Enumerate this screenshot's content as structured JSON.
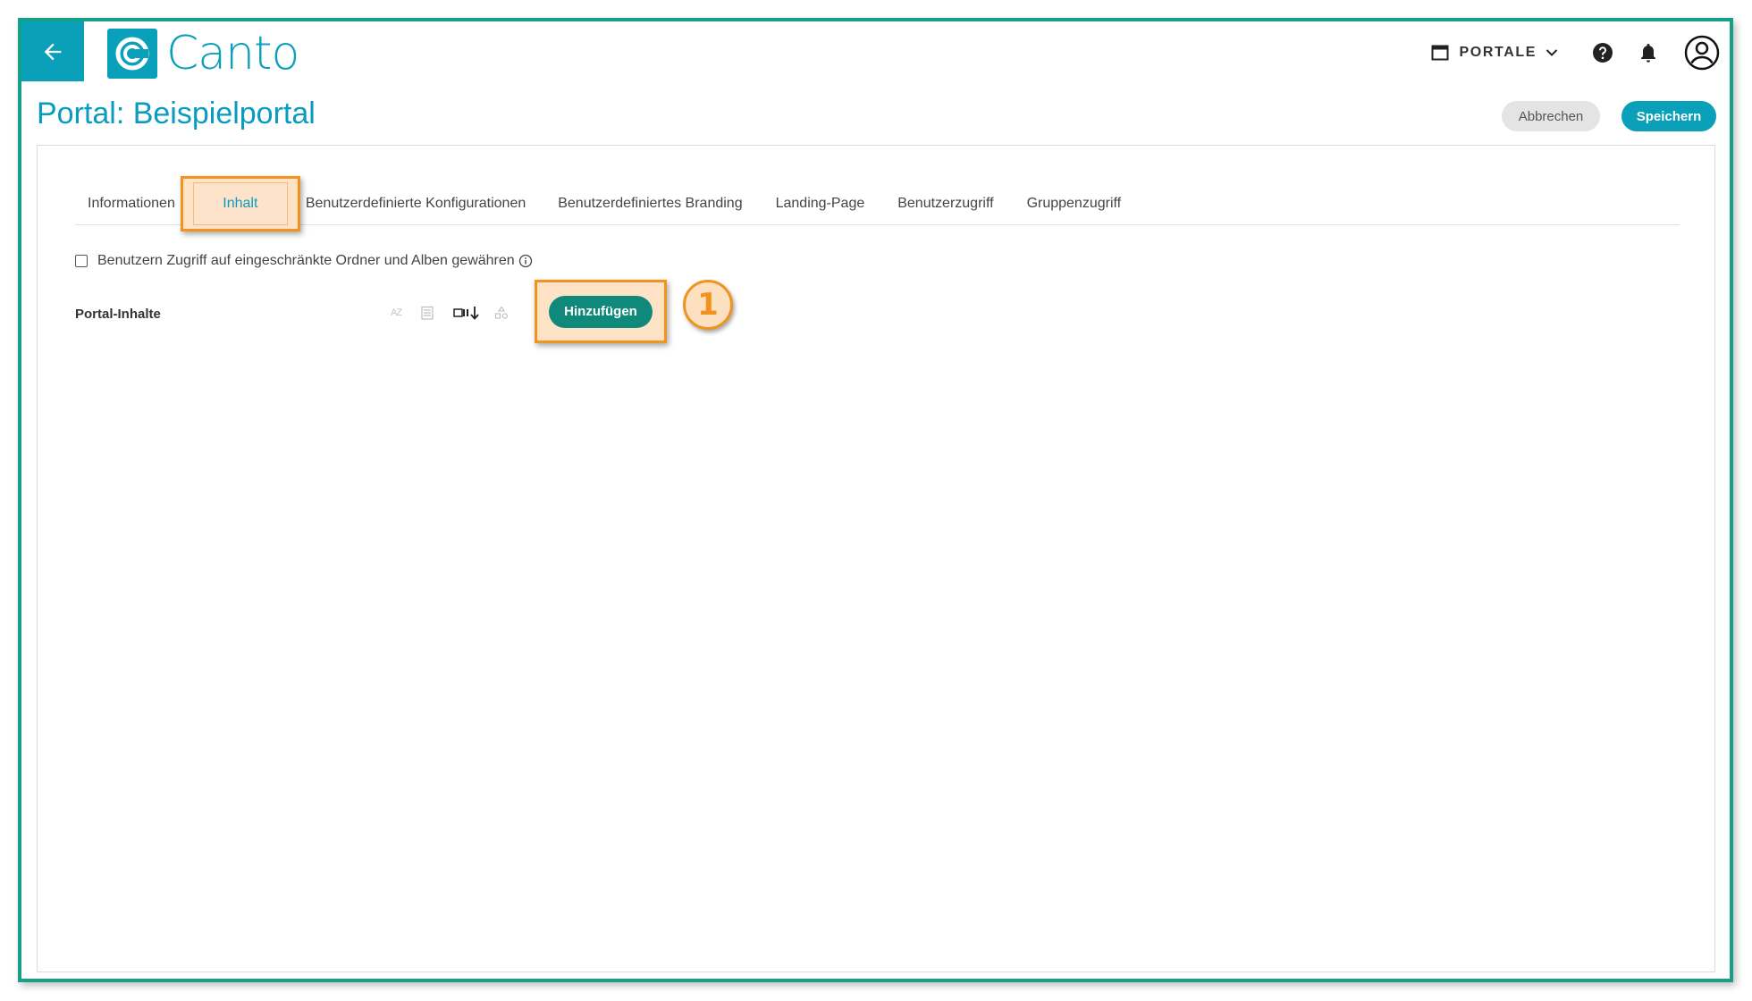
{
  "brand": {
    "name": "Canto",
    "color": "#0aa0b9"
  },
  "header": {
    "portal_menu_label": "PORTALE",
    "icons": [
      "arrow-left-icon",
      "window-icon",
      "chevron-down-icon",
      "help-icon",
      "bell-icon",
      "account-circle-icon"
    ]
  },
  "page": {
    "title": "Portal: Beispielportal",
    "cancel_label": "Abbrechen",
    "save_label": "Speichern"
  },
  "tabs": [
    {
      "label": "Informationen",
      "active": false
    },
    {
      "label": "Inhalt",
      "active": true
    },
    {
      "label": "Benutzerdefinierte Konfigurationen",
      "active": false
    },
    {
      "label": "Benutzerdefiniertes Branding",
      "active": false
    },
    {
      "label": "Landing-Page",
      "active": false
    },
    {
      "label": "Benutzerzugriff",
      "active": false
    },
    {
      "label": "Gruppenzugriff",
      "active": false
    }
  ],
  "content": {
    "restricted_access_label": "Benutzern Zugriff auf eingeschränkte Ordner und Alben gewähren",
    "restricted_access_checked": false,
    "section_label": "Portal-Inhalte",
    "sort_icon_label": "AZ",
    "add_label": "Hinzufügen"
  },
  "annotation": {
    "step_number": "1",
    "highlight_color": "#f0931f"
  },
  "colors": {
    "accent": "#0aa0b9",
    "primary_action": "#0f8a7a",
    "frame": "#16a088"
  }
}
